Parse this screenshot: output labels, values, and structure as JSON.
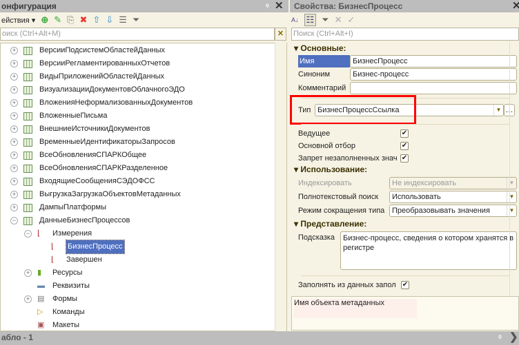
{
  "left": {
    "title": "онфигурация",
    "actions_label": "ействия",
    "search_placeholder": "оиск (Ctrl+Alt+M)",
    "tree": [
      {
        "label": "ВерсииПодсистемОбластейДанных",
        "level": 0,
        "exp": "+",
        "icon": "grid"
      },
      {
        "label": "ВерсииРегламентированныхОтчетов",
        "level": 0,
        "exp": "+",
        "icon": "grid"
      },
      {
        "label": "ВидыПриложенийОбластейДанных",
        "level": 0,
        "exp": "+",
        "icon": "grid"
      },
      {
        "label": "ВизуализацииДокументовОблачногоЭДО",
        "level": 0,
        "exp": "+",
        "icon": "grid"
      },
      {
        "label": "ВложенияНеформализованныхДокументов",
        "level": 0,
        "exp": "+",
        "icon": "grid"
      },
      {
        "label": "ВложенныеПисьма",
        "level": 0,
        "exp": "+",
        "icon": "grid"
      },
      {
        "label": "ВнешниеИсточникиДокументов",
        "level": 0,
        "exp": "+",
        "icon": "grid"
      },
      {
        "label": "ВременныеИдентификаторыЗапросов",
        "level": 0,
        "exp": "+",
        "icon": "grid"
      },
      {
        "label": "ВсеОбновленияСПАРКОбщее",
        "level": 0,
        "exp": "+",
        "icon": "grid"
      },
      {
        "label": "ВсеОбновленияСПАРКРазделенное",
        "level": 0,
        "exp": "+",
        "icon": "grid"
      },
      {
        "label": "ВходящиеСообщенияСЭДОФСС",
        "level": 0,
        "exp": "+",
        "icon": "grid"
      },
      {
        "label": "ВыгрузкаЗагрузкаОбъектовМетаданных",
        "level": 0,
        "exp": "+",
        "icon": "grid"
      },
      {
        "label": "ДампыПлатформы",
        "level": 0,
        "exp": "+",
        "icon": "grid"
      },
      {
        "label": "ДанныеБизнесПроцессов",
        "level": 0,
        "exp": "−",
        "icon": "grid"
      },
      {
        "label": "Измерения",
        "level": 1,
        "exp": "−",
        "icon": "dim"
      },
      {
        "label": "БизнесПроцесс",
        "level": 2,
        "exp": "",
        "icon": "dim",
        "selected": true
      },
      {
        "label": "Завершен",
        "level": 2,
        "exp": "",
        "icon": "dim"
      },
      {
        "label": "Ресурсы",
        "level": 1,
        "exp": "+",
        "icon": "res"
      },
      {
        "label": "Реквизиты",
        "level": 1,
        "exp": "",
        "icon": "attr"
      },
      {
        "label": "Формы",
        "level": 1,
        "exp": "+",
        "icon": "form"
      },
      {
        "label": "Команды",
        "level": 1,
        "exp": "",
        "icon": "cmd"
      },
      {
        "label": "Макеты",
        "level": 1,
        "exp": "",
        "icon": "tpl"
      }
    ],
    "bottom_tab": "абло - 1"
  },
  "right": {
    "title": "Свойства: БизнесПроцесс",
    "search_placeholder": "Поиск (Ctrl+Alt+I)",
    "sections": {
      "main": "Основные:",
      "usage": "Использование:",
      "view": "Представление:"
    },
    "name_label": "Имя",
    "name_value": "БизнесПроцесс",
    "synonym_label": "Синоним",
    "synonym_value": "Бизнес-процесс",
    "comment_label": "Комментарий",
    "comment_value": "",
    "type_label": "Тип",
    "type_value": "БизнесПроцессСсылка",
    "master_label": "Ведущее",
    "main_filter_label": "Основной отбор",
    "deny_empty_label": "Запрет незаполненных знач",
    "index_label": "Индексировать",
    "index_value": "Не индексировать",
    "fulltext_label": "Полнотекстовый поиск",
    "fulltext_value": "Использовать",
    "shorten_label": "Режим сокращения типа",
    "shorten_value": "Преобразовывать значения",
    "tooltip_label": "Подсказка",
    "tooltip_value": "Бизнес-процесс, сведения о котором хранятся в регистре",
    "fill_label": "Заполнять из данных запол",
    "description": "Имя объекта метаданных",
    "highlight_color": "#ff0000"
  }
}
